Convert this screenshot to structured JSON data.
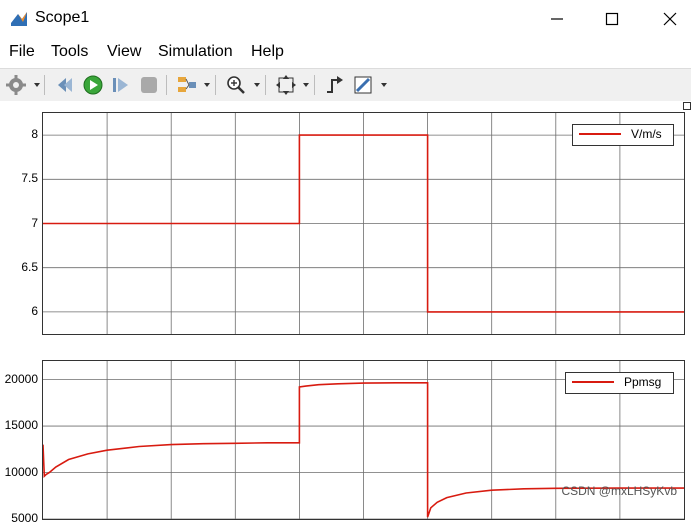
{
  "window": {
    "title": "Scope1",
    "icon": "matlab-icon"
  },
  "menu": [
    "File",
    "Tools",
    "View",
    "Simulation",
    "Help"
  ],
  "toolbar": {
    "icons": [
      "gear-icon",
      "step-back-icon",
      "run-icon",
      "step-forward-icon",
      "stop-icon",
      "signal-selector-icon",
      "zoom-in-icon",
      "fit-axes-icon",
      "triggers-icon",
      "style-icon"
    ]
  },
  "colors": {
    "signal": "#d81b10",
    "grid": "#6d6d6d",
    "axes_border": "#333333"
  },
  "chart_data": [
    {
      "type": "line",
      "title": "",
      "xlabel": "",
      "ylabel": "",
      "ylim": [
        5.75,
        8.25
      ],
      "yticks": [
        "8",
        "7.5",
        "7",
        "6.5",
        "6"
      ],
      "grid": true,
      "legend_position": "top-right",
      "series": [
        {
          "name": "V/m/s",
          "x": [
            0,
            4,
            4,
            6,
            6,
            10
          ],
          "y": [
            7,
            7,
            8,
            8,
            6,
            6
          ]
        }
      ]
    },
    {
      "type": "line",
      "title": "",
      "xlabel": "",
      "ylabel": "",
      "ylim": [
        5000,
        22000
      ],
      "yticks": [
        "20000",
        "15000",
        "10000",
        "5000"
      ],
      "grid": true,
      "legend_position": "top-right",
      "series": [
        {
          "name": "Ppmsg",
          "x": [
            0,
            0.02,
            0.05,
            0.1,
            0.2,
            0.4,
            0.7,
            1.0,
            1.5,
            2.0,
            2.5,
            3.0,
            3.5,
            4.0,
            4.0,
            4.1,
            4.3,
            4.6,
            5.0,
            5.5,
            6.0,
            6.0,
            6.05,
            6.15,
            6.3,
            6.6,
            7.0,
            7.5,
            8.0,
            9.0,
            10.0
          ],
          "y": [
            13000,
            9600,
            9800,
            10000,
            10600,
            11400,
            12000,
            12400,
            12800,
            13000,
            13100,
            13150,
            13200,
            13200,
            19200,
            19300,
            19450,
            19550,
            19620,
            19650,
            19650,
            5200,
            6200,
            6800,
            7300,
            7800,
            8100,
            8250,
            8300,
            8320,
            8320
          ]
        }
      ]
    }
  ],
  "watermark": "CSDN @mxLHSyKvb"
}
